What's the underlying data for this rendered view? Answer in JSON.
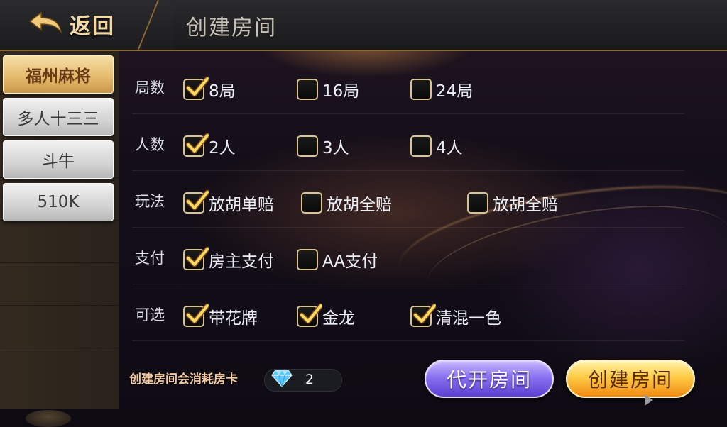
{
  "header": {
    "back_label": "返回",
    "title": "创建房间"
  },
  "sidebar": {
    "tabs": [
      {
        "label": "福州麻将",
        "active": true
      },
      {
        "label": "多人十三三",
        "active": false
      },
      {
        "label": "斗牛",
        "active": false
      },
      {
        "label": "510K",
        "active": false
      }
    ]
  },
  "options": {
    "rounds": {
      "label": "局数",
      "choices": [
        {
          "label": "8局",
          "checked": true
        },
        {
          "label": "16局",
          "checked": false
        },
        {
          "label": "24局",
          "checked": false
        }
      ]
    },
    "players": {
      "label": "人数",
      "choices": [
        {
          "label": "2人",
          "checked": true
        },
        {
          "label": "3人",
          "checked": false
        },
        {
          "label": "4人",
          "checked": false
        }
      ]
    },
    "rules": {
      "label": "玩法",
      "choices": [
        {
          "label": "放胡单赔",
          "checked": true
        },
        {
          "label": "放胡全赔",
          "checked": false
        },
        {
          "label": "放胡全赔",
          "checked": false
        }
      ]
    },
    "payment": {
      "label": "支付",
      "choices": [
        {
          "label": "房主支付",
          "checked": true
        },
        {
          "label": "AA支付",
          "checked": false
        }
      ]
    },
    "extras": {
      "label": "可选",
      "choices": [
        {
          "label": "带花牌",
          "checked": true
        },
        {
          "label": "金龙",
          "checked": true
        },
        {
          "label": "清混一色",
          "checked": true
        }
      ]
    }
  },
  "footer": {
    "cost_label": "创建房间会消耗房卡",
    "gem_count": "2",
    "proxy_button": "代开房间",
    "create_button": "创建房间"
  },
  "colors": {
    "accent_gold": "#e3b86a",
    "create_button": "#ffcb45",
    "proxy_button": "#8a72f0",
    "checkbox_border": "#d9c38f"
  }
}
